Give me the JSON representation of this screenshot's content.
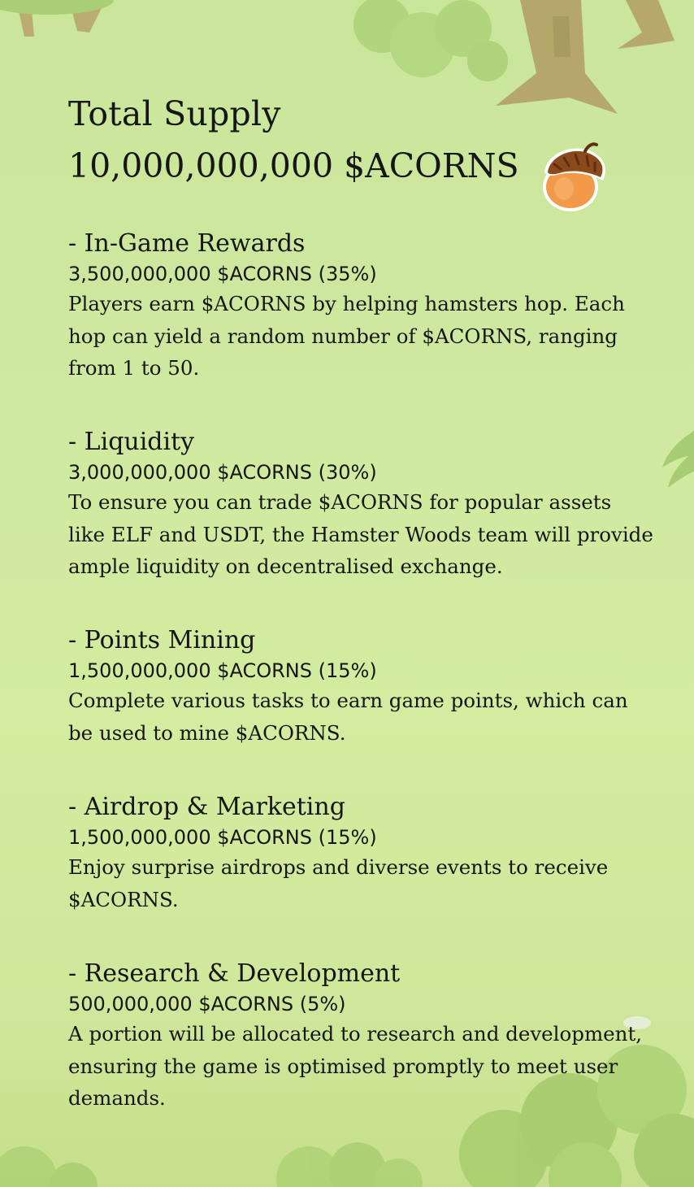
{
  "header": {
    "title": "Total Supply",
    "supply": "10,000,000,000 $ACORNS"
  },
  "sections": [
    {
      "title": "- In-Game Rewards",
      "amount": "3,500,000,000 $ACORNS (35%)",
      "description": "Players earn $ACORNS by helping hamsters hop. Each hop can yield a random number of $ACORNS, ranging from 1 to 50."
    },
    {
      "title": "- Liquidity",
      "amount": "3,000,000,000 $ACORNS (30%)",
      "description": "To ensure you can trade $ACORNS for popular assets like ELF and USDT, the Hamster Woods team will provide ample liquidity on decentralised exchange."
    },
    {
      "title": "- Points Mining",
      "amount": "1,500,000,000 $ACORNS (15%)",
      "description": "Complete various tasks to earn game points, which can be used to mine $ACORNS."
    },
    {
      "title": "- Airdrop & Marketing",
      "amount": "1,500,000,000 $ACORNS (15%)",
      "description": "Enjoy surprise airdrops and diverse events to receive $ACORNS."
    },
    {
      "title": "- Research & Development",
      "amount": "500,000,000 $ACORNS (5%)",
      "description": "A portion will be allocated to research and development, ensuring the game is optimised promptly to meet user demands."
    }
  ],
  "icons": {
    "token": "acorn-icon"
  },
  "colors": {
    "background": "#cfe9a0",
    "text": "#161616",
    "acorn_cap": "#8a4a1c",
    "acorn_body": "#f29a4a"
  }
}
